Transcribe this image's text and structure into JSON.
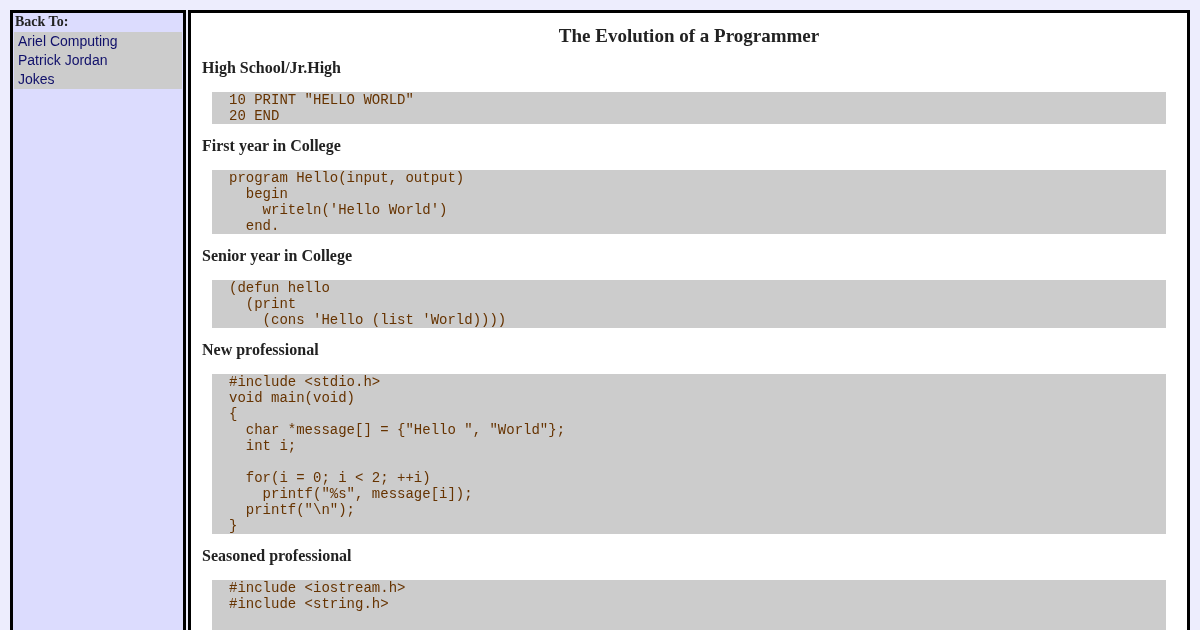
{
  "sidebar": {
    "heading": "Back To:",
    "links": [
      "Ariel Computing",
      "Patrick Jordan",
      "Jokes"
    ]
  },
  "article": {
    "title": "The Evolution of a Programmer",
    "sections": [
      {
        "heading": "High School/Jr.High",
        "code": "10 PRINT \"HELLO WORLD\"\n20 END"
      },
      {
        "heading": "First year in College",
        "code": "program Hello(input, output)\n  begin\n    writeln('Hello World')\n  end."
      },
      {
        "heading": "Senior year in College",
        "code": "(defun hello\n  (print\n    (cons 'Hello (list 'World))))"
      },
      {
        "heading": "New professional",
        "code": "#include <stdio.h>\nvoid main(void)\n{\n  char *message[] = {\"Hello \", \"World\"};\n  int i;\n\n  for(i = 0; i < 2; ++i)\n    printf(\"%s\", message[i]);\n  printf(\"\\n\");\n}"
      },
      {
        "heading": "Seasoned professional",
        "code": "#include <iostream.h>\n#include <string.h>"
      }
    ]
  }
}
